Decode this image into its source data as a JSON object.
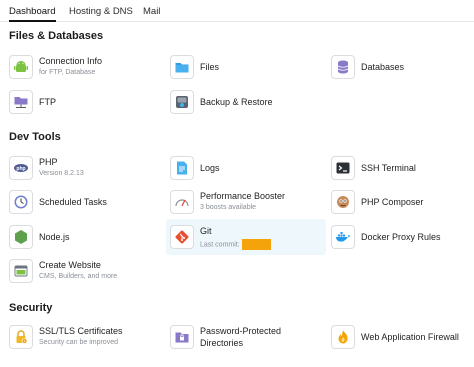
{
  "tabs": [
    {
      "label": "Dashboard"
    },
    {
      "label": "Hosting & DNS"
    },
    {
      "label": "Mail"
    }
  ],
  "sections": {
    "files": {
      "title": "Files & Databases",
      "items": {
        "connection": {
          "label": "Connection Info",
          "sub": "for FTP, Database",
          "icon": "android-icon"
        },
        "files": {
          "label": "Files",
          "icon": "folder-icon"
        },
        "databases": {
          "label": "Databases",
          "icon": "database-icon"
        },
        "ftp": {
          "label": "FTP",
          "icon": "ftp-folder-icon"
        },
        "backup": {
          "label": "Backup & Restore",
          "icon": "backup-icon"
        }
      }
    },
    "dev": {
      "title": "Dev Tools",
      "items": {
        "php": {
          "label": "PHP",
          "sub": "Version 8.2.13",
          "icon": "php-icon"
        },
        "logs": {
          "label": "Logs",
          "icon": "logs-icon"
        },
        "ssh": {
          "label": "SSH Terminal",
          "icon": "terminal-icon"
        },
        "scheduled": {
          "label": "Scheduled Tasks",
          "icon": "clock-icon"
        },
        "perf": {
          "label": "Performance Booster",
          "sub": "3 boosts available",
          "icon": "speedometer-icon"
        },
        "composer": {
          "label": "PHP Composer",
          "icon": "composer-icon"
        },
        "node": {
          "label": "Node.js",
          "icon": "nodejs-icon"
        },
        "git": {
          "label": "Git",
          "sub": "Last commit:",
          "icon": "git-icon"
        },
        "docker": {
          "label": "Docker Proxy Rules",
          "icon": "docker-icon"
        },
        "website": {
          "label": "Create Website",
          "sub": "CMS, Builders, and more",
          "icon": "website-icon"
        }
      }
    },
    "security": {
      "title": "Security",
      "items": {
        "ssl": {
          "label": "SSL/TLS Certificates",
          "sub": "Security can be improved",
          "icon": "lock-icon"
        },
        "password": {
          "label": "Password-Protected",
          "label2": "Directories",
          "icon": "protected-folder-icon"
        },
        "waf": {
          "label": "Web Application Firewall",
          "icon": "fire-icon"
        }
      }
    }
  },
  "colors": {
    "accent": "#1e88c7",
    "redaction": "#f5a30a",
    "highlight": "#eef7fb"
  }
}
